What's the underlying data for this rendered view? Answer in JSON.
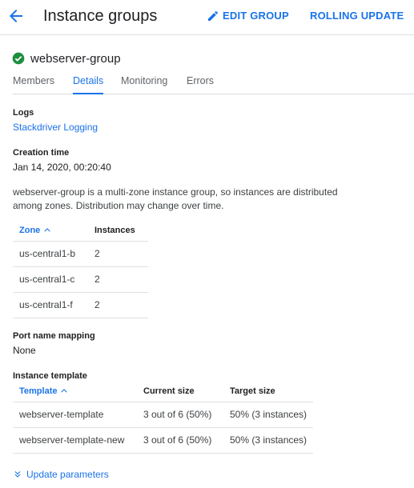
{
  "header": {
    "title": "Instance groups",
    "edit_label": "EDIT GROUP",
    "rolling_label": "ROLLING UPDATE",
    "accent_color": "#1a73e8"
  },
  "group": {
    "name": "webserver-group",
    "status_icon": "check-circle-icon",
    "status_color": "#1e8e3e"
  },
  "tabs": [
    {
      "label": "Members",
      "active": false
    },
    {
      "label": "Details",
      "active": true
    },
    {
      "label": "Monitoring",
      "active": false
    },
    {
      "label": "Errors",
      "active": false
    }
  ],
  "logs": {
    "label": "Logs",
    "link": "Stackdriver Logging"
  },
  "creation": {
    "label": "Creation time",
    "value": "Jan 14, 2020, 00:20:40"
  },
  "description": "webserver-group is a multi-zone instance group, so instances are distributed among zones. Distribution may change over time.",
  "zone_table": {
    "headers": [
      "Zone",
      "Instances"
    ],
    "rows": [
      [
        "us-central1-b",
        "2"
      ],
      [
        "us-central1-c",
        "2"
      ],
      [
        "us-central1-f",
        "2"
      ]
    ]
  },
  "port_mapping": {
    "label": "Port name mapping",
    "value": "None"
  },
  "instance_template": {
    "label": "Instance template",
    "headers": [
      "Template",
      "Current size",
      "Target size"
    ],
    "rows": [
      [
        "webserver-template",
        "3 out of 6 (50%)",
        "50% (3 instances)"
      ],
      [
        "webserver-template-new",
        "3 out of 6 (50%)",
        "50% (3 instances)"
      ]
    ]
  },
  "update_params": {
    "label": "Update parameters",
    "icon": "chevron-double-down-icon"
  }
}
